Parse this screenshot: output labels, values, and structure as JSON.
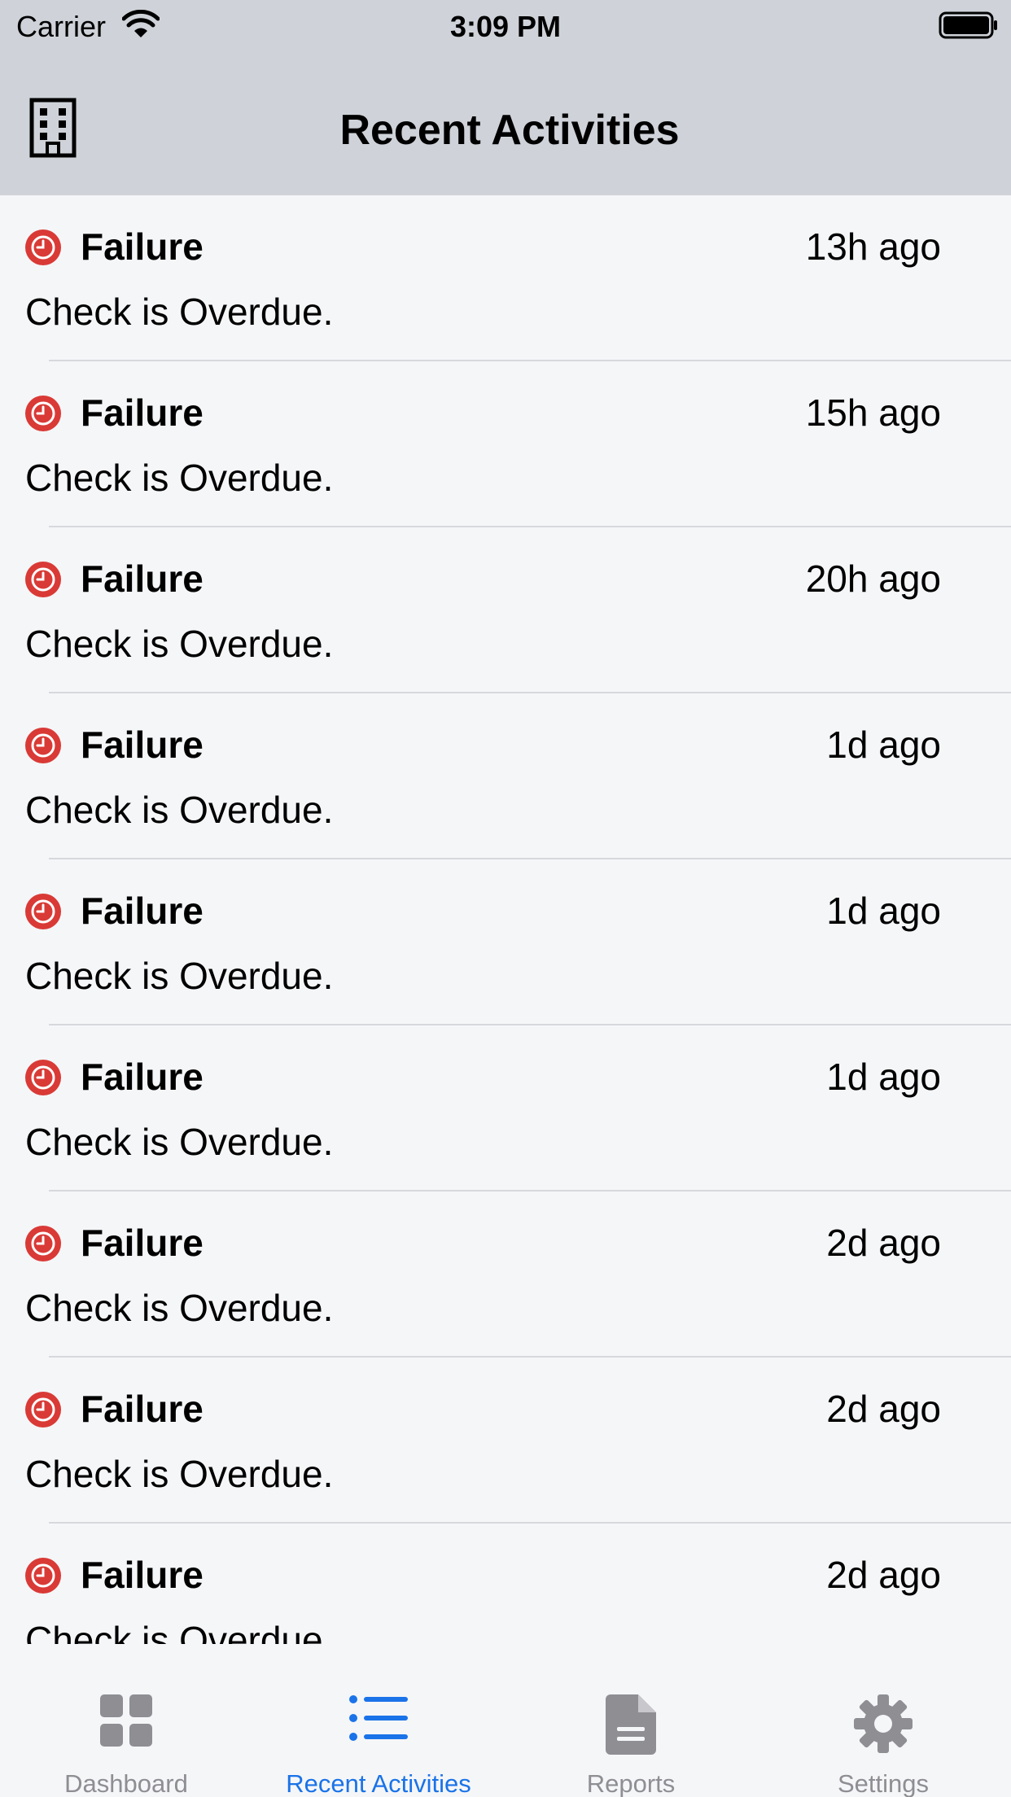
{
  "status_bar": {
    "carrier": "Carrier",
    "time": "3:09 PM"
  },
  "nav": {
    "title": "Recent Activities",
    "icon": "building-icon"
  },
  "activities": [
    {
      "title": "Failure",
      "time": "13h ago",
      "description": "Check is Overdue."
    },
    {
      "title": "Failure",
      "time": "15h ago",
      "description": "Check is Overdue."
    },
    {
      "title": "Failure",
      "time": "20h ago",
      "description": "Check is Overdue."
    },
    {
      "title": "Failure",
      "time": "1d ago",
      "description": "Check is Overdue."
    },
    {
      "title": "Failure",
      "time": "1d ago",
      "description": "Check is Overdue."
    },
    {
      "title": "Failure",
      "time": "1d ago",
      "description": "Check is Overdue."
    },
    {
      "title": "Failure",
      "time": "2d ago",
      "description": "Check is Overdue."
    },
    {
      "title": "Failure",
      "time": "2d ago",
      "description": "Check is Overdue."
    },
    {
      "title": "Failure",
      "time": "2d ago",
      "description": "Check is Overdue."
    }
  ],
  "tabs": [
    {
      "label": "Dashboard",
      "icon": "grid-icon"
    },
    {
      "label": "Recent Activities",
      "icon": "list-icon",
      "active": true
    },
    {
      "label": "Reports",
      "icon": "document-icon"
    },
    {
      "label": "Settings",
      "icon": "gear-icon"
    }
  ],
  "colors": {
    "failure_red": "#d93a36",
    "accent_blue": "#1a73e8",
    "bar_gray": "#cfd3d9",
    "inactive_gray": "#8e8e93"
  }
}
